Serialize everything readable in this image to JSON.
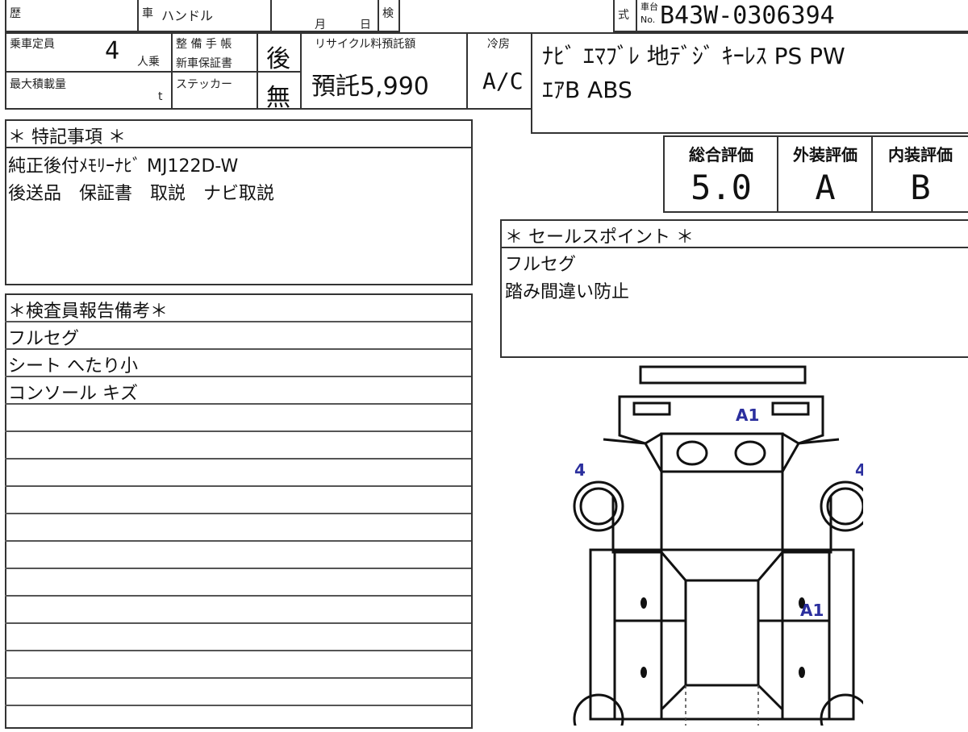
{
  "header": {
    "reki_label": "歴",
    "sha_label": "車",
    "handle_label": "ハンドル",
    "month_label": "月",
    "day_label": "日",
    "ken_label": "検",
    "shiki_label": "式",
    "chassis_label_top": "車台",
    "chassis_label_bottom": "No.",
    "chassis_number": "B43W-0306394"
  },
  "specs": {
    "capacity_label": "乗車定員",
    "capacity_value": "4",
    "capacity_unit": "人乗",
    "maintenance_label_1": "整 備 手 帳",
    "maintenance_label_2": "新車保証書",
    "maintenance_value": "後",
    "max_load_label": "最大積載量",
    "max_load_unit": "t",
    "sticker_label": "ステッカー",
    "sticker_value": "無",
    "recycle_label": "リサイクル料預託額",
    "recycle_value": "預託5,990",
    "aircon_label": "冷房",
    "aircon_value": "A/C"
  },
  "equipment": {
    "line1": "ﾅﾋﾞ ｴﾏﾌﾞﾚ 地ﾃﾞｼﾞ ｷｰﾚｽ PS PW",
    "line2": "ｴｱB ABS"
  },
  "evaluation": {
    "overall_label": "総合評価",
    "overall_value": "5.0",
    "exterior_label": "外装評価",
    "exterior_value": "A",
    "interior_label": "内装評価",
    "interior_value": "B"
  },
  "special_notes": {
    "title": "＊ 特記事項 ＊",
    "line1": "純正後付ﾒﾓﾘｰﾅﾋﾞ MJ122D-W",
    "line2": "後送品　保証書　取説　ナビ取説"
  },
  "sales_points": {
    "title": "＊ セールスポイント ＊",
    "line1": "フルセグ",
    "line2": "踏み間違い防止"
  },
  "inspector_report": {
    "title": "＊検査員報告備考＊",
    "lines": [
      "フルセグ",
      "シート へたり小",
      "コンソール キズ"
    ]
  },
  "diagram": {
    "marks": [
      "A1",
      "4",
      "4",
      "A1"
    ]
  }
}
